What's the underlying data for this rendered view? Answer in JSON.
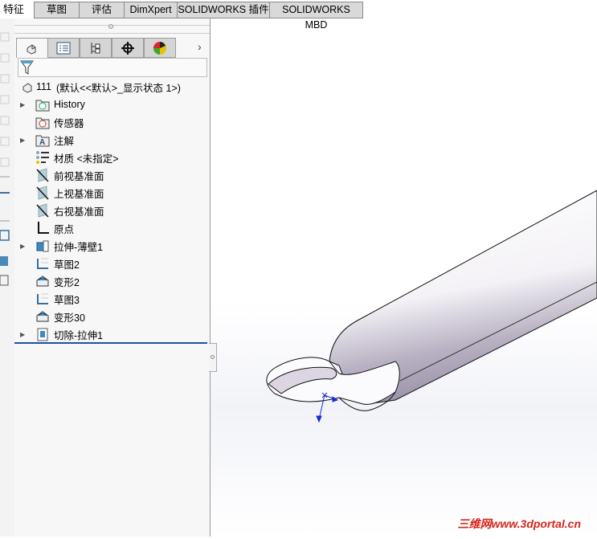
{
  "command_tabs": [
    "特征",
    "草图",
    "评估",
    "DimXpert",
    "SOLIDWORKS 插件",
    "SOLIDWORKS MBD"
  ],
  "panel_tabs": [
    "featuremanager-icon",
    "propertymanager-icon",
    "configurationmanager-icon",
    "dimxpertmanager-icon",
    "displaymanager-icon"
  ],
  "root": {
    "name": "111",
    "config": "(默认<<默认>_显示状态 1>)"
  },
  "tree": [
    {
      "label": "History",
      "icon": "history-folder-icon",
      "expandable": true
    },
    {
      "label": "传感器",
      "icon": "sensor-folder-icon",
      "expandable": false
    },
    {
      "label": "注解",
      "icon": "annotation-folder-icon",
      "expandable": true
    },
    {
      "label": "材质 <未指定>",
      "icon": "material-icon",
      "expandable": false
    },
    {
      "label": "前视基准面",
      "icon": "plane-icon",
      "expandable": false
    },
    {
      "label": "上视基准面",
      "icon": "plane-icon",
      "expandable": false
    },
    {
      "label": "右视基准面",
      "icon": "plane-icon",
      "expandable": false
    },
    {
      "label": "原点",
      "icon": "origin-icon",
      "expandable": false
    },
    {
      "label": "拉伸-薄壁1",
      "icon": "extrude-icon",
      "expandable": true
    },
    {
      "label": "草图2",
      "icon": "sketch-icon",
      "expandable": false
    },
    {
      "label": "变形2",
      "icon": "deform-icon",
      "expandable": false
    },
    {
      "label": "草图3",
      "icon": "sketch-icon",
      "expandable": false
    },
    {
      "label": "变形30",
      "icon": "deform-icon",
      "expandable": false
    },
    {
      "label": "切除-拉伸1",
      "icon": "cut-extrude-icon",
      "expandable": true
    }
  ],
  "watermark": "三维网www.3dportal.cn",
  "colors": {
    "rollback_bar": "#1f4fa8",
    "watermark": "#d8241c"
  }
}
